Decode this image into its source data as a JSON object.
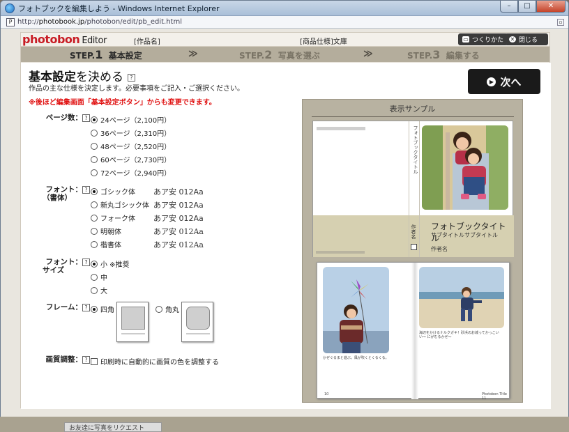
{
  "window": {
    "title": "フォトブックを編集しよう - Windows Internet Explorer",
    "min": "–",
    "max": "□",
    "close": "✕"
  },
  "address": {
    "prefix": "http://",
    "domain": "photobook.jp",
    "path": "/photobon/edit/pb_edit.html"
  },
  "header": {
    "logo": "photobon",
    "logo_suffix": "Editor",
    "work_name": "[作品名]",
    "spec": "[商品仕様]文庫",
    "howto_label": "つくりかた",
    "close_label": "閉じる"
  },
  "steps": [
    {
      "label": "STEP.",
      "num": "1",
      "name": "基本設定"
    },
    {
      "label": "STEP.",
      "num": "2",
      "name": "写真を選ぶ"
    },
    {
      "label": "STEP.",
      "num": "3",
      "name": "編集する"
    }
  ],
  "arrow": "≫",
  "main": {
    "title_strong": "基本設定",
    "title_rest": "を決める",
    "help": "?",
    "desc": "作品の主な仕様を決定します。必要事項をご記入・ご選択ください。",
    "note": "※後ほど編集画面「基本設定ボタン」からも変更できます。",
    "next_label": "次へ"
  },
  "pages": {
    "label": "ページ数：",
    "options": [
      "24ページ（2,100円）",
      "36ページ（2,310円）",
      "48ページ（2,520円）",
      "60ページ（2,730円）",
      "72ページ（2,940円）"
    ],
    "selected": 0
  },
  "font": {
    "label1": "フォント：",
    "label2": "（書体）",
    "options": [
      "ゴシック体",
      "新丸ゴシック体",
      "フォーク体",
      "明朝体",
      "楷書体"
    ],
    "sample": "あア安 012Aa",
    "selected": 0
  },
  "fontsize": {
    "label1": "フォント：",
    "label2": "サイズ",
    "options": [
      "小 ※推奨",
      "中",
      "大"
    ],
    "selected": 0
  },
  "frame": {
    "label": "フレーム：",
    "options": [
      "四角",
      "角丸"
    ],
    "selected": 0
  },
  "quality": {
    "label": "画質調整：",
    "checkbox_label": "印刷時に自動的に画質の色を調整する",
    "checked": false
  },
  "preview": {
    "title": "表示サンプル",
    "spine_title": "フォトブックタイトル",
    "spine_author": "作者名",
    "book_title": "フォトブックタイトル",
    "book_subtitle": "サブタイトルサブタイトル",
    "book_author": "作者名",
    "caption_left": "かぜぐるまと遊ぶ。風が吹くとくるくる。",
    "caption_right": "海辺をかけるナルクガキ！砂浜のお城ってかっこいい〜 にがむるかぜ〜",
    "page_left": "10",
    "page_right": "Photobon Title  11"
  },
  "taskbar": {
    "tab": "お友達に写真をリクエスト"
  },
  "colors": {
    "accent_red": "#c81c24",
    "step_bar": "#b4ad9c",
    "next_btn": "#1a1a1a",
    "cover_band": "#d6d0b1"
  }
}
